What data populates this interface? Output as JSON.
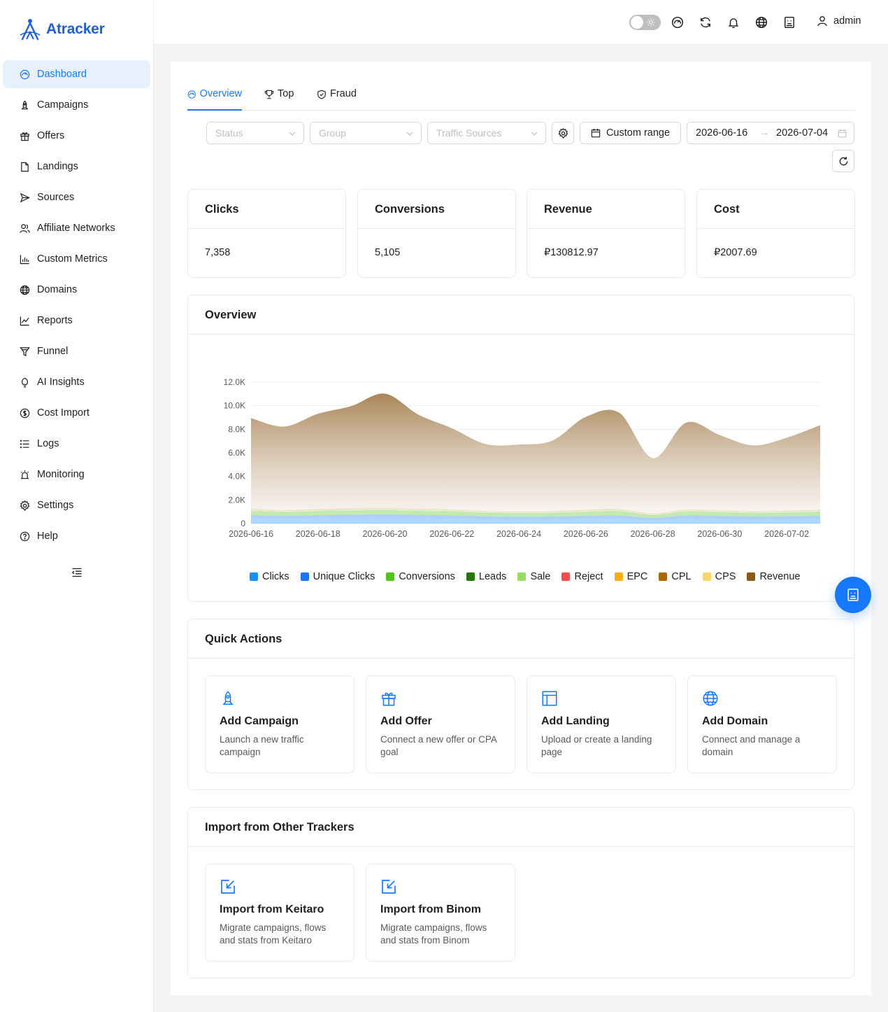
{
  "brand": {
    "name": "Atracker"
  },
  "sidebar": {
    "items": [
      {
        "label": "Dashboard",
        "icon": "dashboard-icon"
      },
      {
        "label": "Campaigns",
        "icon": "rocket-icon"
      },
      {
        "label": "Offers",
        "icon": "gift-icon"
      },
      {
        "label": "Landings",
        "icon": "file-icon"
      },
      {
        "label": "Sources",
        "icon": "send-icon"
      },
      {
        "label": "Affiliate Networks",
        "icon": "users-icon"
      },
      {
        "label": "Custom Metrics",
        "icon": "bar-chart-icon"
      },
      {
        "label": "Domains",
        "icon": "globe-icon"
      },
      {
        "label": "Reports",
        "icon": "line-chart-icon"
      },
      {
        "label": "Funnel",
        "icon": "funnel-icon"
      },
      {
        "label": "AI Insights",
        "icon": "bulb-icon"
      },
      {
        "label": "Cost Import",
        "icon": "dollar-icon"
      },
      {
        "label": "Logs",
        "icon": "list-icon"
      },
      {
        "label": "Monitoring",
        "icon": "alarm-icon"
      },
      {
        "label": "Settings",
        "icon": "gear-icon"
      },
      {
        "label": "Help",
        "icon": "help-icon"
      }
    ]
  },
  "header": {
    "user": "admin"
  },
  "tabs": [
    "Overview",
    "Top",
    "Fraud"
  ],
  "filters": {
    "status_placeholder": "Status",
    "group_placeholder": "Group",
    "sources_placeholder": "Traffic Sources",
    "custom_range": "Custom range",
    "date_from": "2026-06-16",
    "date_to": "2026-07-04",
    "arrow": "→"
  },
  "stats": [
    {
      "title": "Clicks",
      "value": "7,358"
    },
    {
      "title": "Conversions",
      "value": "5,105"
    },
    {
      "title": "Revenue",
      "value": "₽130812.97"
    },
    {
      "title": "Cost",
      "value": "₽2007.69"
    }
  ],
  "overview": {
    "title": "Overview"
  },
  "chart_data": {
    "type": "area",
    "x": [
      "2026-06-16",
      "2026-06-17",
      "2026-06-18",
      "2026-06-19",
      "2026-06-20",
      "2026-06-21",
      "2026-06-22",
      "2026-06-23",
      "2026-06-24",
      "2026-06-25",
      "2026-06-26",
      "2026-06-27",
      "2026-06-28",
      "2026-06-29",
      "2026-06-30",
      "2026-07-01",
      "2026-07-02",
      "2026-07-03"
    ],
    "x_ticks": [
      "2026-06-16",
      "2026-06-18",
      "2026-06-20",
      "2026-06-22",
      "2026-06-24",
      "2026-06-26",
      "2026-06-28",
      "2026-06-30",
      "2026-07-02"
    ],
    "y_ticks": [
      "0",
      "2.0K",
      "4.0K",
      "6.0K",
      "8.0K",
      "10.0K",
      "12.0K"
    ],
    "ylim": [
      0,
      12000
    ],
    "stacked": true,
    "legend_position": "bottom",
    "grid": true,
    "series": [
      {
        "name": "Clicks",
        "color": "#1890ff",
        "values": [
          420,
          380,
          410,
          430,
          450,
          420,
          400,
          350,
          330,
          340,
          380,
          400,
          280,
          390,
          370,
          340,
          360,
          380
        ]
      },
      {
        "name": "Unique Clicks",
        "color": "#1677ff",
        "values": [
          300,
          280,
          300,
          310,
          320,
          300,
          290,
          260,
          250,
          250,
          280,
          290,
          200,
          290,
          270,
          250,
          260,
          280
        ]
      },
      {
        "name": "Conversions",
        "color": "#52c41a",
        "values": [
          290,
          260,
          280,
          300,
          310,
          290,
          280,
          240,
          230,
          240,
          270,
          280,
          190,
          270,
          260,
          240,
          250,
          270
        ]
      },
      {
        "name": "Leads",
        "color": "#237804",
        "values": [
          30,
          30,
          30,
          30,
          30,
          30,
          30,
          30,
          30,
          30,
          30,
          30,
          30,
          30,
          30,
          30,
          30,
          30
        ]
      },
      {
        "name": "Sale",
        "color": "#95de64",
        "values": [
          150,
          130,
          140,
          150,
          160,
          150,
          140,
          120,
          110,
          120,
          140,
          150,
          100,
          140,
          130,
          120,
          130,
          140
        ]
      },
      {
        "name": "Reject",
        "color": "#ff4d4f",
        "values": [
          20,
          20,
          20,
          20,
          20,
          20,
          20,
          20,
          20,
          20,
          20,
          20,
          20,
          20,
          20,
          20,
          20,
          20
        ]
      },
      {
        "name": "EPC",
        "color": "#faad14",
        "values": [
          10,
          10,
          10,
          10,
          10,
          10,
          10,
          10,
          10,
          10,
          10,
          10,
          10,
          10,
          10,
          10,
          10,
          10
        ]
      },
      {
        "name": "CPL",
        "color": "#ad6800",
        "values": [
          10,
          10,
          10,
          10,
          10,
          10,
          10,
          10,
          10,
          10,
          10,
          10,
          10,
          10,
          10,
          10,
          10,
          10
        ]
      },
      {
        "name": "CPS",
        "color": "#ffd666",
        "values": [
          10,
          10,
          10,
          10,
          10,
          10,
          10,
          10,
          10,
          10,
          10,
          10,
          10,
          10,
          10,
          10,
          10,
          10
        ]
      },
      {
        "name": "Revenue",
        "color": "#8b5a16",
        "values": [
          7700,
          7100,
          8100,
          8700,
          9700,
          8000,
          6900,
          5700,
          5700,
          6000,
          7900,
          8200,
          4700,
          7400,
          6400,
          5600,
          6200,
          7200
        ]
      }
    ]
  },
  "quick_actions": {
    "title": "Quick Actions",
    "items": [
      {
        "title": "Add Campaign",
        "desc": "Launch a new traffic campaign"
      },
      {
        "title": "Add Offer",
        "desc": "Connect a new offer or CPA goal"
      },
      {
        "title": "Add Landing",
        "desc": "Upload or create a landing page"
      },
      {
        "title": "Add Domain",
        "desc": "Connect and manage a domain"
      }
    ]
  },
  "imports": {
    "title": "Import from Other Trackers",
    "items": [
      {
        "title": "Import from Keitaro",
        "desc": "Migrate campaigns, flows and stats from Keitaro"
      },
      {
        "title": "Import from Binom",
        "desc": "Migrate campaigns, flows and stats from Binom"
      }
    ]
  },
  "colors": {
    "accent": "#1677ff",
    "brand": "#1e5fd8",
    "active_bg": "#e6f1fd"
  }
}
